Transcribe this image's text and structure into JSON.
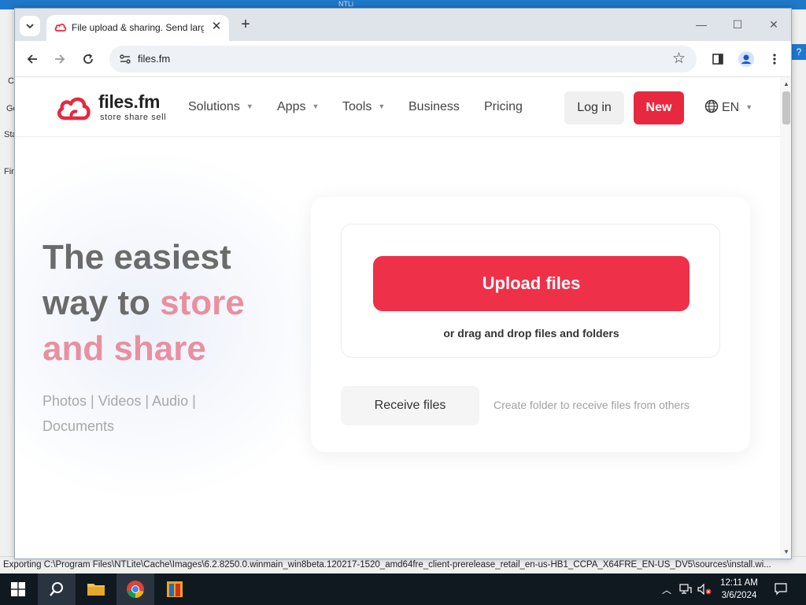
{
  "background_app": {
    "title": "NTLi",
    "left_fragments": [
      "C",
      "Ge",
      "Sta",
      "Fir"
    ],
    "status_text": "Exporting C:\\Program Files\\NTLite\\Cache\\Images\\6.2.8250.0.winmain_win8beta.120217-1520_amd64fre_client-prerelease_retail_en-us-HB1_CCPA_X64FRE_EN-US_DV5\\sources\\install.wi..."
  },
  "browser": {
    "tab_title": "File upload & sharing. Send larg",
    "address": "files.fm",
    "window_controls": [
      "minimize",
      "maximize",
      "close"
    ]
  },
  "site": {
    "logo": {
      "name": "files.fm",
      "tagline": "store  share  sell"
    },
    "nav": [
      {
        "label": "Solutions",
        "dropdown": true
      },
      {
        "label": "Apps",
        "dropdown": true
      },
      {
        "label": "Tools",
        "dropdown": true
      },
      {
        "label": "Business",
        "dropdown": false
      },
      {
        "label": "Pricing",
        "dropdown": false
      }
    ],
    "login_label": "Log in",
    "new_label": "New",
    "language": "EN"
  },
  "hero": {
    "title_part1": "The easiest",
    "title_part2": "way to ",
    "title_highlight1": "store",
    "title_highlight2": "and share",
    "subtitle_line1": "Photos | Videos | Audio |",
    "subtitle_line2": "Documents"
  },
  "upload_card": {
    "upload_label": "Upload files",
    "drag_text": "or drag and drop files and folders",
    "receive_label": "Receive files",
    "receive_hint": "Create folder to receive files from others"
  },
  "taskbar": {
    "time": "12:11 AM",
    "date": "3/6/2024"
  },
  "colors": {
    "brand_red": "#ee3049",
    "new_button": "#e8283e",
    "hero_pink": "#e890a0",
    "hero_gray": "#6b6b6b"
  }
}
